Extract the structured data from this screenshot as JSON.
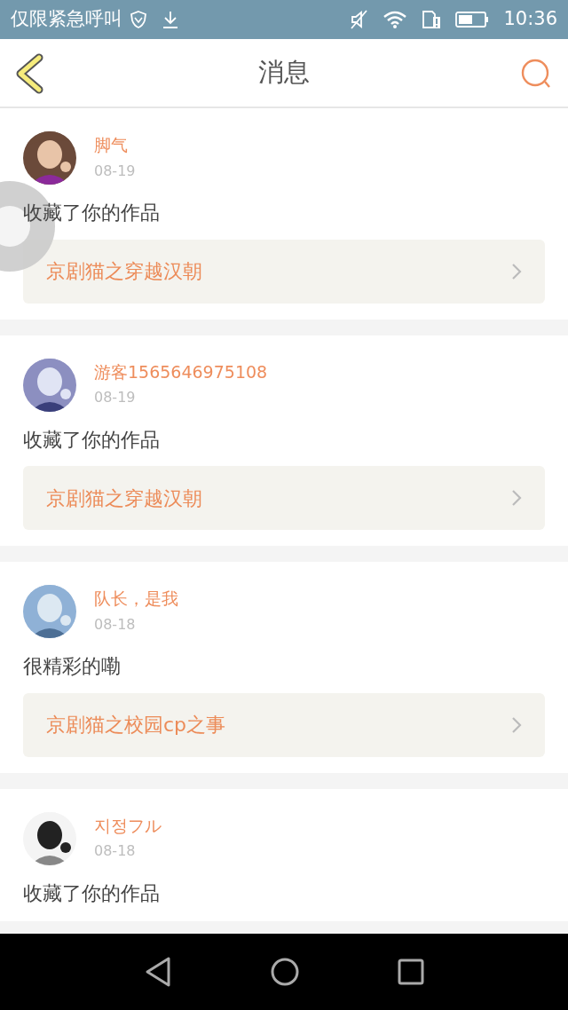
{
  "status_bar": {
    "carrier": "仅限紧急呼叫",
    "time": "10:36"
  },
  "header": {
    "title": "消息"
  },
  "messages": [
    {
      "user": "脚气",
      "date": "08-19",
      "text": "收藏了你的作品",
      "work": "京剧猫之穿越汉朝"
    },
    {
      "user": "游客1565646975108",
      "date": "08-19",
      "text": "收藏了你的作品",
      "work": "京剧猫之穿越汉朝"
    },
    {
      "user": "队长，是我",
      "date": "08-18",
      "text": "很精彩的嘞",
      "work": "京剧猫之校园cp之事"
    },
    {
      "user": "지정フル",
      "date": "08-18",
      "text": "收藏了你的作品"
    }
  ]
}
